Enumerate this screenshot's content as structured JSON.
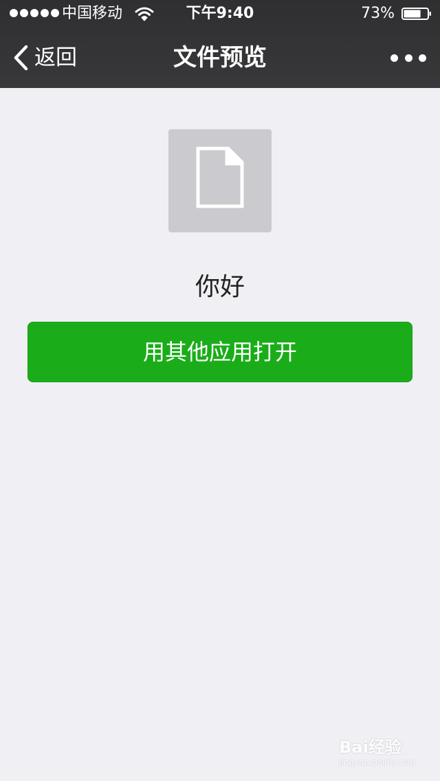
{
  "status_bar": {
    "carrier": "中国移动",
    "time": "下午9:40",
    "battery_percent": "73%",
    "battery_level": 0.73,
    "signal_icon": "signal-dots-icon",
    "wifi_icon": "wifi-icon",
    "battery_icon": "battery-icon"
  },
  "nav": {
    "back_label": "返回",
    "back_icon": "chevron-left-icon",
    "title": "文件预览",
    "more_icon": "ellipsis-icon"
  },
  "file": {
    "icon": "document-icon",
    "name": "你好"
  },
  "actions": {
    "open_with_label": "用其他应用打开"
  },
  "watermark": {
    "text": "Bai经验",
    "sub": "jingyan.baidu.com"
  },
  "colors": {
    "nav_background": "#343436",
    "page_background": "#efeff4",
    "primary_button": "#1aad19",
    "file_thumb": "#cacacf"
  }
}
